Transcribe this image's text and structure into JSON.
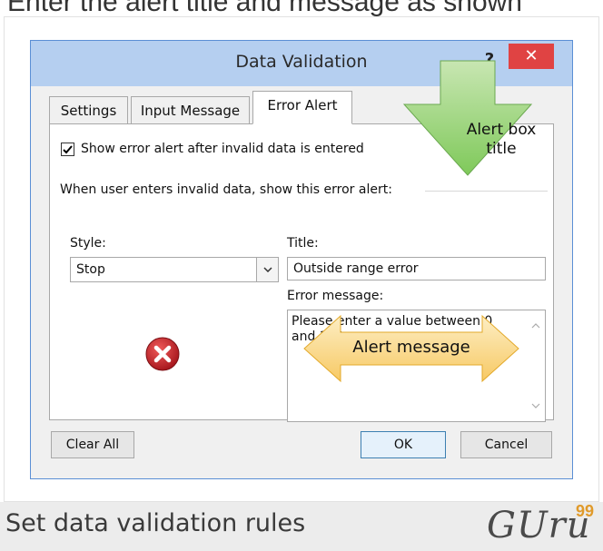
{
  "top_caption": "Enter the alert title and message as shown",
  "dialog": {
    "title": "Data Validation",
    "help_label": "?",
    "close_label": "✕"
  },
  "tabs": [
    {
      "label": "Settings"
    },
    {
      "label": "Input Message"
    },
    {
      "label": "Error Alert",
      "active": true
    }
  ],
  "error_alert": {
    "show_alert_checked": true,
    "show_alert_label": "Show error alert after invalid data is entered",
    "instruction": "When user enters invalid data, show this error alert:",
    "style_label": "Style:",
    "style_value": "Stop",
    "title_label": "Title:",
    "title_value": "Outside range error",
    "error_message_label": "Error message:",
    "error_message_value": "Please enter a value between 0 and 100."
  },
  "callouts": {
    "title_callout": "Alert box title",
    "message_callout": "Alert message"
  },
  "buttons": {
    "clear_all": "Clear All",
    "ok": "OK",
    "cancel": "Cancel"
  },
  "footer": {
    "caption": "Set data validation rules",
    "logo": "GUru",
    "logo_sup": "99"
  },
  "colors": {
    "titlebar": "#b5cff0",
    "close_button": "#e04343",
    "stop_icon": "#c1272d",
    "callout_green": "#9fd67f",
    "callout_yellow": "#fbd88a"
  },
  "icons": [
    "checkbox-checked-icon",
    "chevron-down-icon",
    "stop-error-icon",
    "scroll-up-icon",
    "scroll-down-icon"
  ]
}
